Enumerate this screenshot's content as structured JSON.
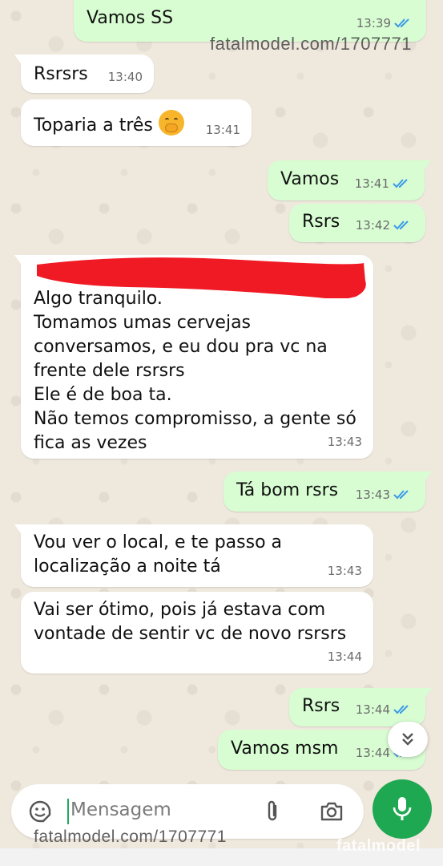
{
  "messages": [
    {
      "dir": "out",
      "text": "Vamos SS",
      "time": "13:39",
      "read": true
    },
    {
      "dir": "in",
      "text": "Rsrsrs",
      "time": "13:40"
    },
    {
      "dir": "in",
      "text": "Toparia a três",
      "time": "13:41",
      "emoji": "hand-over-mouth-emoji"
    },
    {
      "dir": "out",
      "text": "Vamos",
      "time": "13:41",
      "read": true
    },
    {
      "dir": "out",
      "text": "Rsrs",
      "time": "13:42",
      "read": true
    },
    {
      "dir": "in",
      "text": "Algo tranquilo.\nTomamos umas cervejas\nconversamos, e eu dou pra vc na\nfrente dele rsrsrs\nEle é de boa ta.\nNão temos compromisso, a gente só\nfica as vezes",
      "time": "13:43",
      "redacted_top": true
    },
    {
      "dir": "out",
      "text": "Tá bom rsrs",
      "time": "13:43",
      "read": true
    },
    {
      "dir": "in",
      "text": "Vou ver o local, e te passo a\nlocalização a noite tá",
      "time": "13:43"
    },
    {
      "dir": "in",
      "text": "Vai ser ótimo, pois já estava com\nvontade de sentir vc de novo rsrsrs",
      "time": "13:44"
    },
    {
      "dir": "out",
      "text": "Rsrs",
      "time": "13:44",
      "read": true
    },
    {
      "dir": "out",
      "text": "Vamos msm",
      "time": "13:44",
      "read": true
    }
  ],
  "composer": {
    "placeholder": "Mensagem",
    "icons": [
      "sticker-icon",
      "attach-icon",
      "camera-icon",
      "mic-icon"
    ]
  },
  "watermarks": {
    "top": "fatalmodel.com/1707771",
    "bottom": "fatalmodel.com/1707771",
    "brand": "fatalmodel"
  },
  "colors": {
    "incoming_bubble": "#ffffff",
    "outgoing_bubble": "#d8fdd2",
    "read_tick": "#3b9ae8",
    "mic_button": "#1da851",
    "redaction": "#ef1a24"
  }
}
